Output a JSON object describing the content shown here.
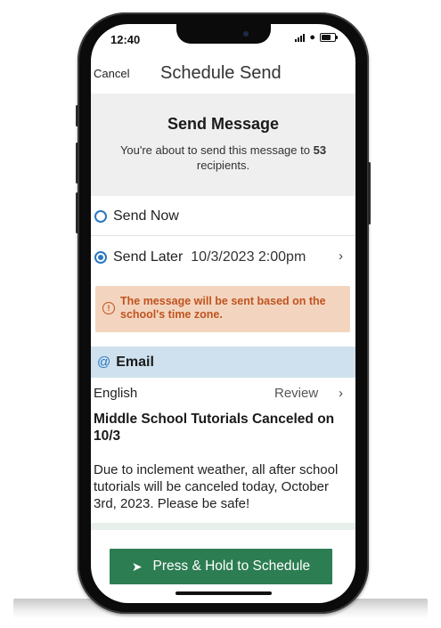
{
  "status_bar": {
    "time": "12:40"
  },
  "nav": {
    "cancel_label": "Cancel",
    "title": "Schedule Send"
  },
  "header": {
    "title": "Send Message",
    "subtitle_prefix": "You're about to send this message to ",
    "recipient_count": "53",
    "subtitle_suffix": " recipients."
  },
  "options": {
    "send_now_label": "Send Now",
    "send_later_label": "Send Later",
    "scheduled_datetime": "10/3/2023 2:00pm",
    "selected": "send_later"
  },
  "alert": {
    "text": "The message will be sent based on the school's time zone."
  },
  "email": {
    "section_label": "Email",
    "language": "English",
    "review_label": "Review",
    "subject": "Middle School Tutorials Canceled on 10/3",
    "body": "Due to inclement weather, all after school tutorials will be canceled today, October 3rd, 2023. Please be safe!"
  },
  "action": {
    "button_label": "Press & Hold to Schedule"
  },
  "colors": {
    "accent_blue": "#2a78c2",
    "alert_bg": "#f3d5bf",
    "alert_text": "#c0531f",
    "email_bar_bg": "#cfe1ee",
    "button_green": "#2c7d52"
  },
  "icons": {
    "alert": "exclamation-circle",
    "email": "at-sign",
    "button": "paper-plane",
    "chevron": "chevron-right"
  }
}
